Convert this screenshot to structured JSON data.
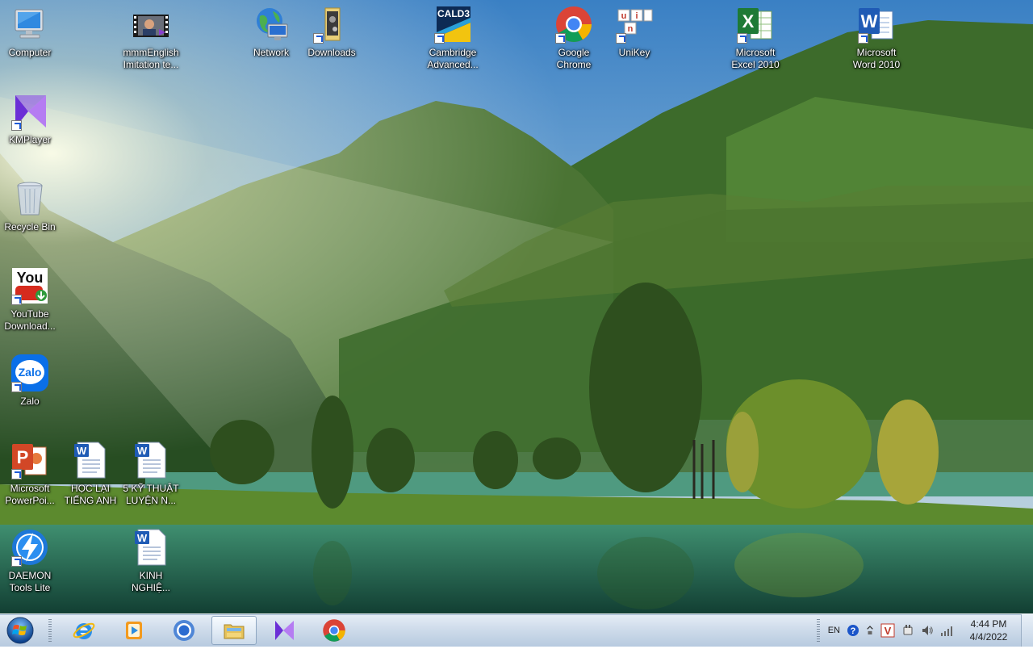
{
  "desktop": {
    "icons": [
      {
        "name": "computer",
        "label": "Computer",
        "icon": "computer-icon",
        "shortcut": false
      },
      {
        "name": "mmmenglish",
        "label": "mmmEnglish\nImitation te...",
        "icon": "video-file-icon",
        "shortcut": false
      },
      {
        "name": "network",
        "label": "Network",
        "icon": "network-globe-icon",
        "shortcut": false
      },
      {
        "name": "downloads",
        "label": "Downloads",
        "icon": "downloads-folder-icon",
        "shortcut": true
      },
      {
        "name": "cambridge",
        "label": "Cambridge\nAdvanced...",
        "icon": "cald3-icon",
        "shortcut": true
      },
      {
        "name": "google-chrome",
        "label": "Google\nChrome",
        "icon": "chrome-icon",
        "shortcut": true
      },
      {
        "name": "unikey",
        "label": "UniKey",
        "icon": "unikey-icon",
        "shortcut": true
      },
      {
        "name": "excel",
        "label": "Microsoft\nExcel 2010",
        "icon": "excel-icon",
        "shortcut": true
      },
      {
        "name": "word",
        "label": "Microsoft\nWord 2010",
        "icon": "word-icon",
        "shortcut": true
      },
      {
        "name": "kmplayer",
        "label": "KMPlayer",
        "icon": "kmplayer-icon",
        "shortcut": true
      },
      {
        "name": "recycle-bin",
        "label": "Recycle Bin",
        "icon": "recycle-bin-icon",
        "shortcut": false
      },
      {
        "name": "youtube-downloader",
        "label": "YouTube\nDownload...",
        "icon": "youtube-icon",
        "shortcut": true
      },
      {
        "name": "zalo",
        "label": "Zalo",
        "icon": "zalo-icon",
        "shortcut": true
      },
      {
        "name": "powerpoint",
        "label": "Microsoft\nPowerPoi...",
        "icon": "powerpoint-icon",
        "shortcut": true
      },
      {
        "name": "hoc-lai-tieng-anh",
        "label": "HỌC LẠI\nTIẾNG ANH",
        "icon": "word-document-icon",
        "shortcut": false
      },
      {
        "name": "5-ky-thuat",
        "label": "5 KỸ THUẬT\nLUYỆN N...",
        "icon": "word-document-icon",
        "shortcut": false
      },
      {
        "name": "daemon-tools",
        "label": "DAEMON\nTools Lite",
        "icon": "daemon-tools-icon",
        "shortcut": true
      },
      {
        "name": "kinh-nghiem",
        "label": "KINH\nNGHIỆ...",
        "icon": "word-document-icon",
        "shortcut": false
      }
    ],
    "icon_texts": {
      "youtube": "You",
      "zalo": "Zalo",
      "cald3": "CALD3",
      "unikey_letters": [
        "u",
        "i",
        "n"
      ]
    }
  },
  "taskbar": {
    "pinned": [
      {
        "name": "internet-explorer",
        "icon": "internet-explorer-icon",
        "active": false
      },
      {
        "name": "media-player",
        "icon": "media-player-icon",
        "active": false
      },
      {
        "name": "chrome-alt",
        "icon": "chromium-icon",
        "active": false
      },
      {
        "name": "windows-explorer",
        "icon": "folder-icon",
        "active": true
      },
      {
        "name": "kmplayer",
        "icon": "kmplayer-icon",
        "active": false
      },
      {
        "name": "google-chrome",
        "icon": "chrome-icon",
        "active": false
      }
    ],
    "tray": {
      "language": "EN",
      "help_icon": "help-icon",
      "overflow_icon": "chevron-up-icon",
      "unikey_tray": "V",
      "clock_time": "4:44 PM",
      "clock_date": "4/4/2022"
    }
  },
  "colors": {
    "taskbar_top": "#e6eef6",
    "taskbar_bottom": "#b7cadf",
    "label_text": "#ffffff"
  }
}
